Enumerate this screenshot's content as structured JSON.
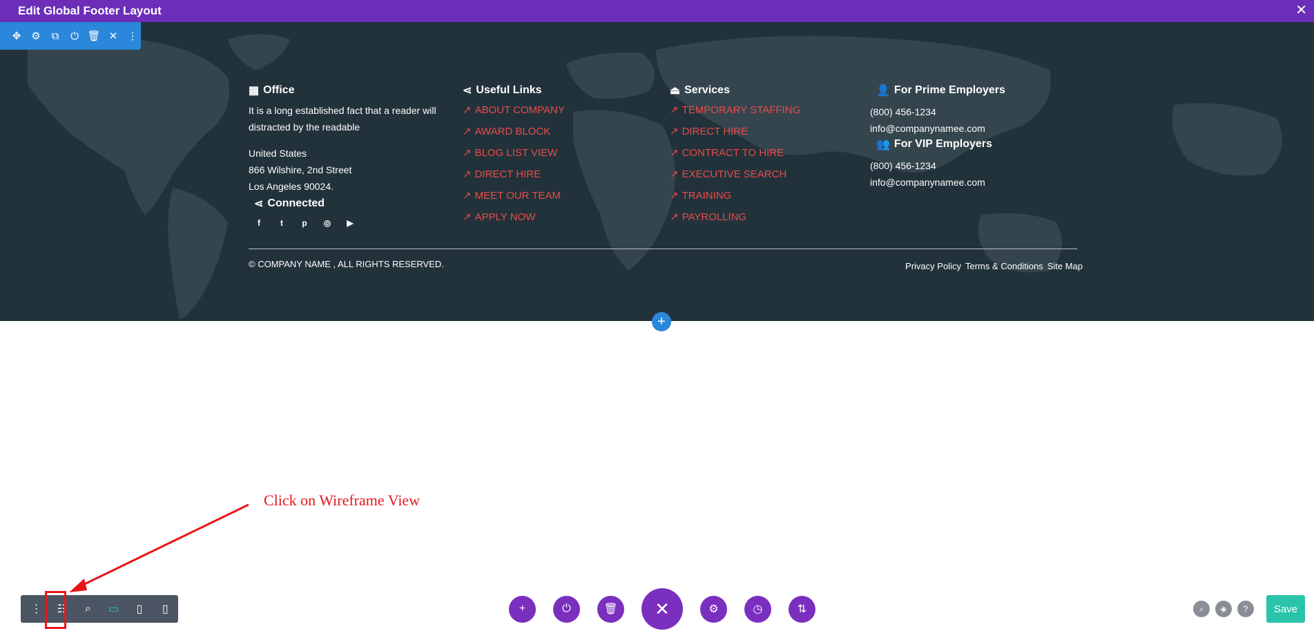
{
  "window": {
    "title": "Edit Global Footer Layout",
    "close_icon": "close-icon"
  },
  "section_toolbar": {
    "icons": [
      "move-icon",
      "gear-icon",
      "duplicate-icon",
      "power-icon",
      "trash-icon",
      "close-icon",
      "more-icon"
    ],
    "glyphs": [
      "✥",
      "⚙",
      "⧉",
      "⏻",
      "🗑",
      "✕",
      "⋮"
    ]
  },
  "footer": {
    "office": {
      "heading": "Office",
      "description": "It is a long established fact that a reader will distracted by the readable",
      "address": [
        "United States",
        "866 Wilshire, 2nd Street",
        "Los Angeles 90024."
      ]
    },
    "connected": {
      "heading": "Connected",
      "socials": [
        {
          "name": "facebook-icon",
          "glyph": "f"
        },
        {
          "name": "twitter-icon",
          "glyph": "t"
        },
        {
          "name": "pinterest-icon",
          "glyph": "p"
        },
        {
          "name": "instagram-icon",
          "glyph": "◎"
        },
        {
          "name": "youtube-icon",
          "glyph": "▶"
        }
      ]
    },
    "useful_links": {
      "heading": "Useful Links",
      "links": [
        "ABOUT COMPANY",
        "AWARD BLOCK",
        "BLOG LIST VIEW",
        "DIRECT HIRE",
        "MEET OUR TEAM",
        "APPLY NOW"
      ]
    },
    "services": {
      "heading": "Services",
      "links": [
        "TEMPORARY STAFFING",
        "DIRECT HIRE",
        "CONTRACT TO HIRE",
        "EXECUTIVE SEARCH",
        "TRAINING",
        "PAYROLLING"
      ]
    },
    "prime": {
      "heading": "For Prime Employers",
      "phone": "(800) 456-1234",
      "email": "info@companynamee.com"
    },
    "vip": {
      "heading": "For VIP Employers",
      "phone": "(800) 456-1234",
      "email": "info@companynamee.com"
    },
    "copyright": "© COMPANY NAME , ALL RIGHTS RESERVED.",
    "legal": [
      "Privacy Policy",
      "Terms & Conditions",
      "Site Map"
    ],
    "link_color": "#e84b4b",
    "background": "#22323a"
  },
  "annotation": {
    "text": "Click on Wireframe View",
    "color": "#e8151b"
  },
  "bottom_toolbar": {
    "items": [
      {
        "name": "more-icon",
        "glyph": "⋮"
      },
      {
        "name": "wireframe-view-icon",
        "glyph": "☷"
      },
      {
        "name": "zoom-icon",
        "glyph": "⌕"
      },
      {
        "name": "desktop-view-icon",
        "glyph": "▭"
      },
      {
        "name": "tablet-view-icon",
        "glyph": "▯"
      },
      {
        "name": "phone-view-icon",
        "glyph": "▯"
      }
    ],
    "active": "desktop-view-icon"
  },
  "center_controls": [
    {
      "name": "add-icon",
      "glyph": "+"
    },
    {
      "name": "power-icon",
      "glyph": "⏻"
    },
    {
      "name": "trash-icon",
      "glyph": "🗑"
    },
    {
      "name": "close-icon",
      "glyph": "✕"
    },
    {
      "name": "gear-icon",
      "glyph": "⚙"
    },
    {
      "name": "history-icon",
      "glyph": "◷"
    },
    {
      "name": "sort-icon",
      "glyph": "⇅"
    }
  ],
  "right_controls": [
    {
      "name": "search-icon",
      "glyph": "⌕"
    },
    {
      "name": "layers-icon",
      "glyph": "◈"
    },
    {
      "name": "help-icon",
      "glyph": "?"
    }
  ],
  "save_label": "Save",
  "add_row_glyph": "+"
}
